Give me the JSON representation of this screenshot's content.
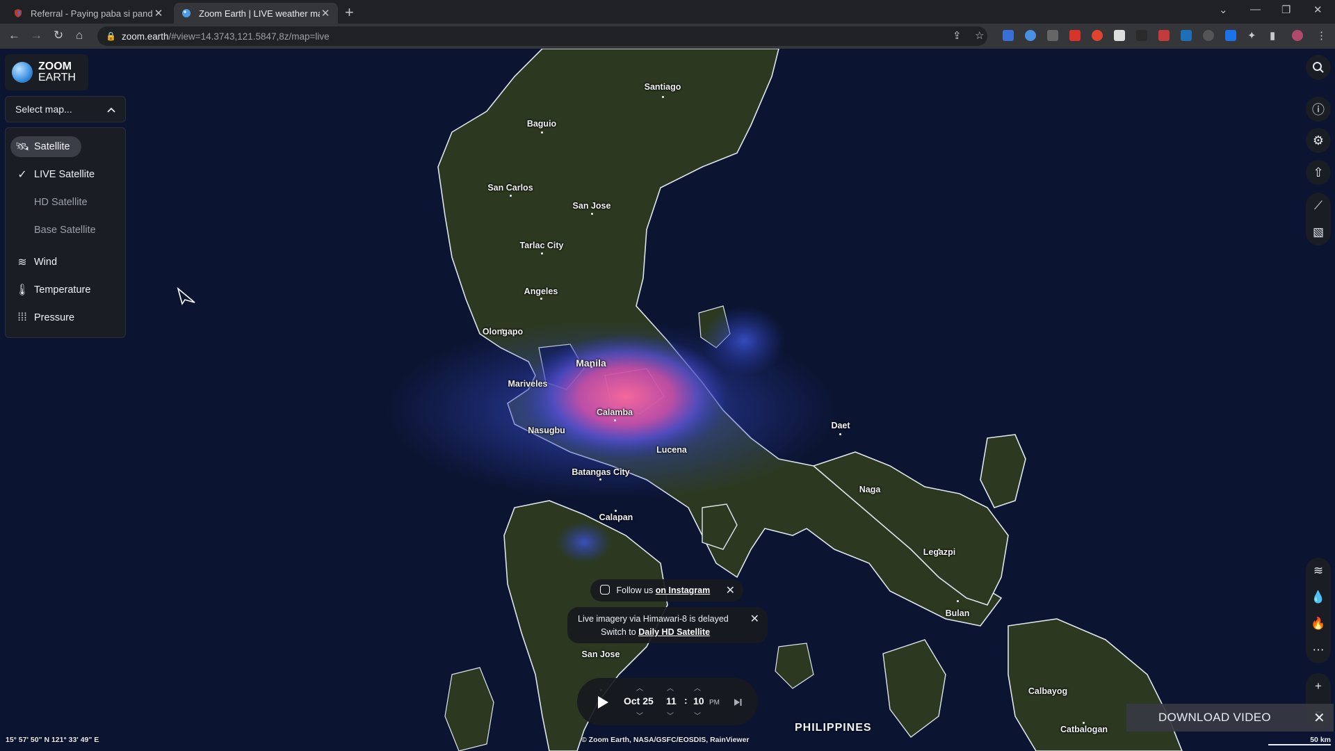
{
  "browser": {
    "tabs": [
      {
        "title": "Referral - Paying paba si pandora",
        "close": "✕"
      },
      {
        "title": "Zoom Earth | LIVE weather map,",
        "close": "✕"
      }
    ],
    "new_tab": "+",
    "url_host": "zoom.earth",
    "url_path": "/#view=14.3743,121.5847,8z/map=live"
  },
  "app": {
    "logo_line1": "ZOOM",
    "logo_line2": "EARTH",
    "select_map": "Select map...",
    "menu": {
      "satellite": "Satellite",
      "live_satellite": "LIVE Satellite",
      "hd_satellite": "HD Satellite",
      "base_satellite": "Base Satellite",
      "wind": "Wind",
      "temperature": "Temperature",
      "pressure": "Pressure"
    }
  },
  "map": {
    "places": [
      {
        "name": "Santiago"
      },
      {
        "name": "Baguio"
      },
      {
        "name": "San Carlos"
      },
      {
        "name": "San Jose"
      },
      {
        "name": "Tarlac City"
      },
      {
        "name": "Angeles"
      },
      {
        "name": "Olongapo"
      },
      {
        "name": "Manila"
      },
      {
        "name": "Mariveles"
      },
      {
        "name": "Calamba"
      },
      {
        "name": "Nasugbu"
      },
      {
        "name": "Lucena"
      },
      {
        "name": "Batangas City"
      },
      {
        "name": "Calapan"
      },
      {
        "name": "Daet"
      },
      {
        "name": "Naga"
      },
      {
        "name": "Legazpi"
      },
      {
        "name": "Bulan"
      },
      {
        "name": "San Jose"
      },
      {
        "name": "Calbayog"
      },
      {
        "name": "Catbalogan"
      }
    ],
    "country": "PHILIPPINES"
  },
  "notices": {
    "instagram_prefix": "Follow us",
    "instagram_link": "on Instagram",
    "delay_line1": "Live imagery via Himawari-8 is delayed",
    "delay_prefix": "Switch to",
    "delay_link": "Daily HD Satellite"
  },
  "timeline": {
    "date": "Oct 25",
    "hour": "11",
    "sep": ":",
    "minute": "10",
    "ampm": "PM"
  },
  "footer": {
    "coords": "15° 57' 50\" N   121° 33' 49\" E",
    "credit": "© Zoom Earth, NASA/GSFC/EOSDIS, RainViewer",
    "scale": "50 km",
    "download": "DOWNLOAD VIDEO"
  },
  "colors": {
    "radar_light": "#3a4ec8",
    "radar_heavy": "#e0508a",
    "land": "#2f3a22",
    "ocean": "#0b1430"
  }
}
